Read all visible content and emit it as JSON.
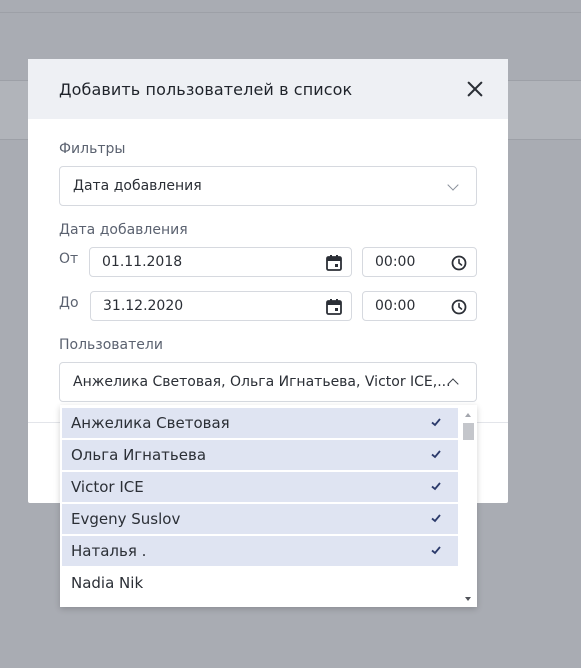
{
  "modal": {
    "title": "Добавить пользователей в список",
    "close_icon": "close-icon"
  },
  "filters": {
    "label": "Фильтры",
    "selected": "Дата добавления"
  },
  "date_section": {
    "label": "Дата добавления",
    "from_label": "От",
    "from_date": "01.11.2018",
    "from_time": "00:00",
    "to_label": "До",
    "to_date": "31.12.2020",
    "to_time": "00:00",
    "date_icon": "calendar-icon",
    "time_icon": "clock-icon"
  },
  "users": {
    "label": "Пользователи",
    "selected_summary": "Анжелика Световая, Ольга Игнатьева, Victor ICE,...",
    "options": [
      {
        "label": "Анжелика Световая",
        "selected": true
      },
      {
        "label": "Ольга Игнатьева",
        "selected": true
      },
      {
        "label": "Victor ICE",
        "selected": true
      },
      {
        "label": "Evgeny Suslov",
        "selected": true
      },
      {
        "label": "Наталья .",
        "selected": true
      },
      {
        "label": "Nadia Nik",
        "selected": false
      }
    ]
  },
  "colors": {
    "overlay": "#a9acb3",
    "header_bg": "#eef0f4",
    "selected_row": "#dfe4f2",
    "check": "#2b3a6b"
  }
}
